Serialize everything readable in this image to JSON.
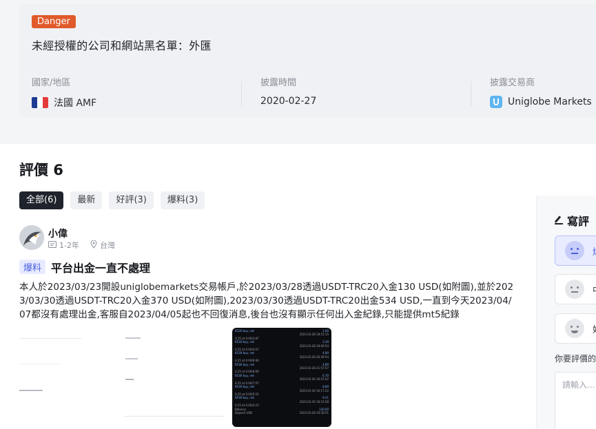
{
  "danger": {
    "badge": "Danger",
    "title": "未經授權的公司和網站黑名單：外匯",
    "fields": [
      {
        "label": "國家/地區",
        "value": "法國 AMF"
      },
      {
        "label": "披露時間",
        "value": "2020-02-27"
      },
      {
        "label": "披露交易商",
        "value": "Uniglobe Markets"
      }
    ],
    "flag_colors": [
      "#1f3a93",
      "#ffffff",
      "#e33b3b"
    ],
    "broker_logo_color": "#5fb6f0"
  },
  "reviews": {
    "title": "評價 6",
    "filters": [
      "全部(6)",
      "最新",
      "好評(3)",
      "爆料(3)"
    ],
    "active_filter": "全部(6)"
  },
  "review": {
    "user_name": "小偉",
    "duration": "1-2年",
    "location": "台灣",
    "tag": "爆料",
    "title": "平台出金一直不處理",
    "body": "本人於2023/03/23開設uniglobemarkets交易帳戶,於2023/03/28透過USDT-TRC20入金130 USD(如附圖),並於2023/03/30透過USDT-TRC20入金370 USD(如附圖),2023/03/30透過USDT-TRC20出金534 USD,一直到今天2023/04/07都沒有處理出金,客服自2023/04/05起也不回復消息,後台也沒有顯示任何出入金紀錄,只能提供mt5紀錄",
    "screenshot_rows": [
      {
        "left": "6530 buy, net",
        "right": "2023.03.28 18:15:15",
        "val": "1.00"
      },
      {
        "left": "0.25 at 0.00/3.87",
        "right": "",
        "val": ""
      },
      {
        "left": "6530 buy, net",
        "right": "2023.03.28 19:00:54",
        "val": "3.39"
      },
      {
        "left": "0.25 at 0.00/4.67",
        "right": "",
        "val": ""
      },
      {
        "left": "6530 buy, net",
        "right": "2023.03.28 20:39:54",
        "val": "4.80"
      },
      {
        "left": "0.25 at 0.00/8.96",
        "right": "",
        "val": ""
      },
      {
        "left": "6530 buy, net",
        "right": "2023.03.28 21:57:57",
        "val": "4.89"
      },
      {
        "left": "0.25 at 0.00/8.60",
        "right": "",
        "val": ""
      },
      {
        "left": "6530 buy, net",
        "right": "2023.03.30 16:15:52",
        "val": "6.70"
      },
      {
        "left": "0.25 at 0.00/7.07",
        "right": "",
        "val": ""
      },
      {
        "left": "6530 buy, net",
        "right": "2023.03.30 16:17:22",
        "val": "8.89"
      },
      {
        "left": "0.25 at 0.00/9.52",
        "right": "",
        "val": ""
      },
      {
        "left": "6530 buy, net",
        "right": "2023.03.30 16:15:58",
        "val": "9.21"
      },
      {
        "left": "0.25 at 0.00/4.23",
        "right": "",
        "val": ""
      },
      {
        "left": "Balance",
        "right": "",
        "val": "130.00"
      },
      {
        "left": "Deposit USD",
        "right": "2023.03.28 16:30:51",
        "val": ""
      }
    ]
  },
  "sidebar": {
    "write_title": "寫評",
    "options": [
      {
        "label": "爆",
        "active": true
      },
      {
        "label": "中",
        "active": false
      },
      {
        "label": "好",
        "active": false
      }
    ],
    "ask": "你要評價的",
    "placeholder": "請輸入..."
  }
}
